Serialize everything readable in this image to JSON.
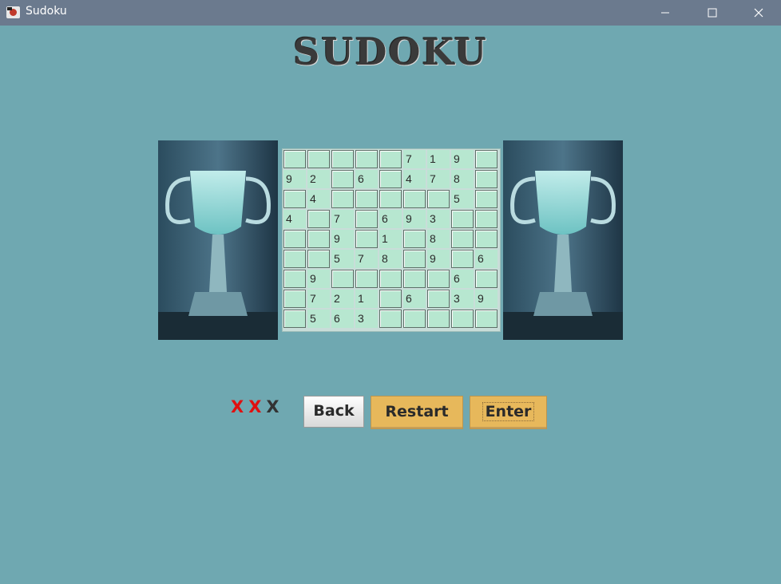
{
  "window": {
    "title": "Sudoku",
    "controls": [
      "minimize",
      "maximize",
      "close"
    ]
  },
  "heading": "SUDOKU",
  "grid": [
    [
      "",
      "",
      "",
      "",
      "",
      "7",
      "1",
      "9",
      ""
    ],
    [
      "9",
      "2",
      "",
      "6",
      "",
      "4",
      "7",
      "8",
      ""
    ],
    [
      "",
      "4",
      "",
      "",
      "",
      "",
      "",
      "5",
      ""
    ],
    [
      "4",
      "",
      "7",
      "",
      "6",
      "9",
      "3",
      "",
      ""
    ],
    [
      "",
      "",
      "9",
      "",
      "1",
      "",
      "8",
      "",
      ""
    ],
    [
      "",
      "",
      "5",
      "7",
      "8",
      "",
      "9",
      "",
      "6"
    ],
    [
      "",
      "9",
      "",
      "",
      "",
      "",
      "",
      "6",
      ""
    ],
    [
      "",
      "7",
      "2",
      "1",
      "",
      "6",
      "",
      "3",
      "9"
    ],
    [
      "",
      "5",
      "6",
      "3",
      "",
      "",
      "",
      "",
      ""
    ]
  ],
  "marks": [
    {
      "text": "X",
      "color": "#e01010"
    },
    {
      "text": "X",
      "color": "#e01010"
    },
    {
      "text": "X",
      "color": "#333333"
    }
  ],
  "buttons": {
    "back": "Back",
    "restart": "Restart",
    "enter": "Enter"
  },
  "images": {
    "trophy_left": "trophy-cup-image",
    "trophy_right": "trophy-cup-image"
  }
}
